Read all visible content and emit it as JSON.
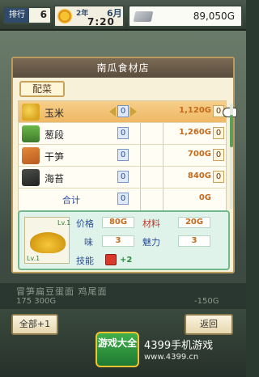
{
  "topbar": {
    "rank_label": "排行",
    "rank_value": "6",
    "year": "2年",
    "month": "6月",
    "time": "7:20",
    "money": "89,050G"
  },
  "dialog": {
    "title": "南瓜食材店",
    "tab_label": "配菜",
    "items": [
      {
        "name": "玉米",
        "qty": "0",
        "price": "1,120G",
        "stock": "0",
        "icon": "corn-icon",
        "selected": true
      },
      {
        "name": "葱段",
        "qty": "0",
        "price": "1,260G",
        "stock": "0",
        "icon": "leek-icon",
        "selected": false
      },
      {
        "name": "干笋",
        "qty": "0",
        "price": "700G",
        "stock": "0",
        "icon": "bamboo-shoot-icon",
        "selected": false
      },
      {
        "name": "海苔",
        "qty": "0",
        "price": "840G",
        "stock": "0",
        "icon": "nori-icon",
        "selected": false
      }
    ],
    "total": {
      "label": "合计",
      "qty": "0",
      "price": "0G"
    },
    "detail": {
      "level_top": "Lv.1",
      "level_bottom": "Lv.1",
      "price_label": "价格",
      "price_value": "80G",
      "material_label": "材料",
      "material_value": "20G",
      "taste_label": "味",
      "taste_value": "3",
      "charm_label": "魅力",
      "charm_value": "3",
      "skill_label": "技能",
      "skill_value": "+2"
    }
  },
  "background": {
    "line1": "冒笋扁豆蛋面 鸡尾面",
    "line2": "175 300G",
    "line3": "-150G"
  },
  "bottom": {
    "all_button": "全部+1",
    "back_button": "返回",
    "watermark_logo": "游戏大全",
    "watermark_name": "4399手机游戏",
    "watermark_url": "www.4399.cn"
  }
}
